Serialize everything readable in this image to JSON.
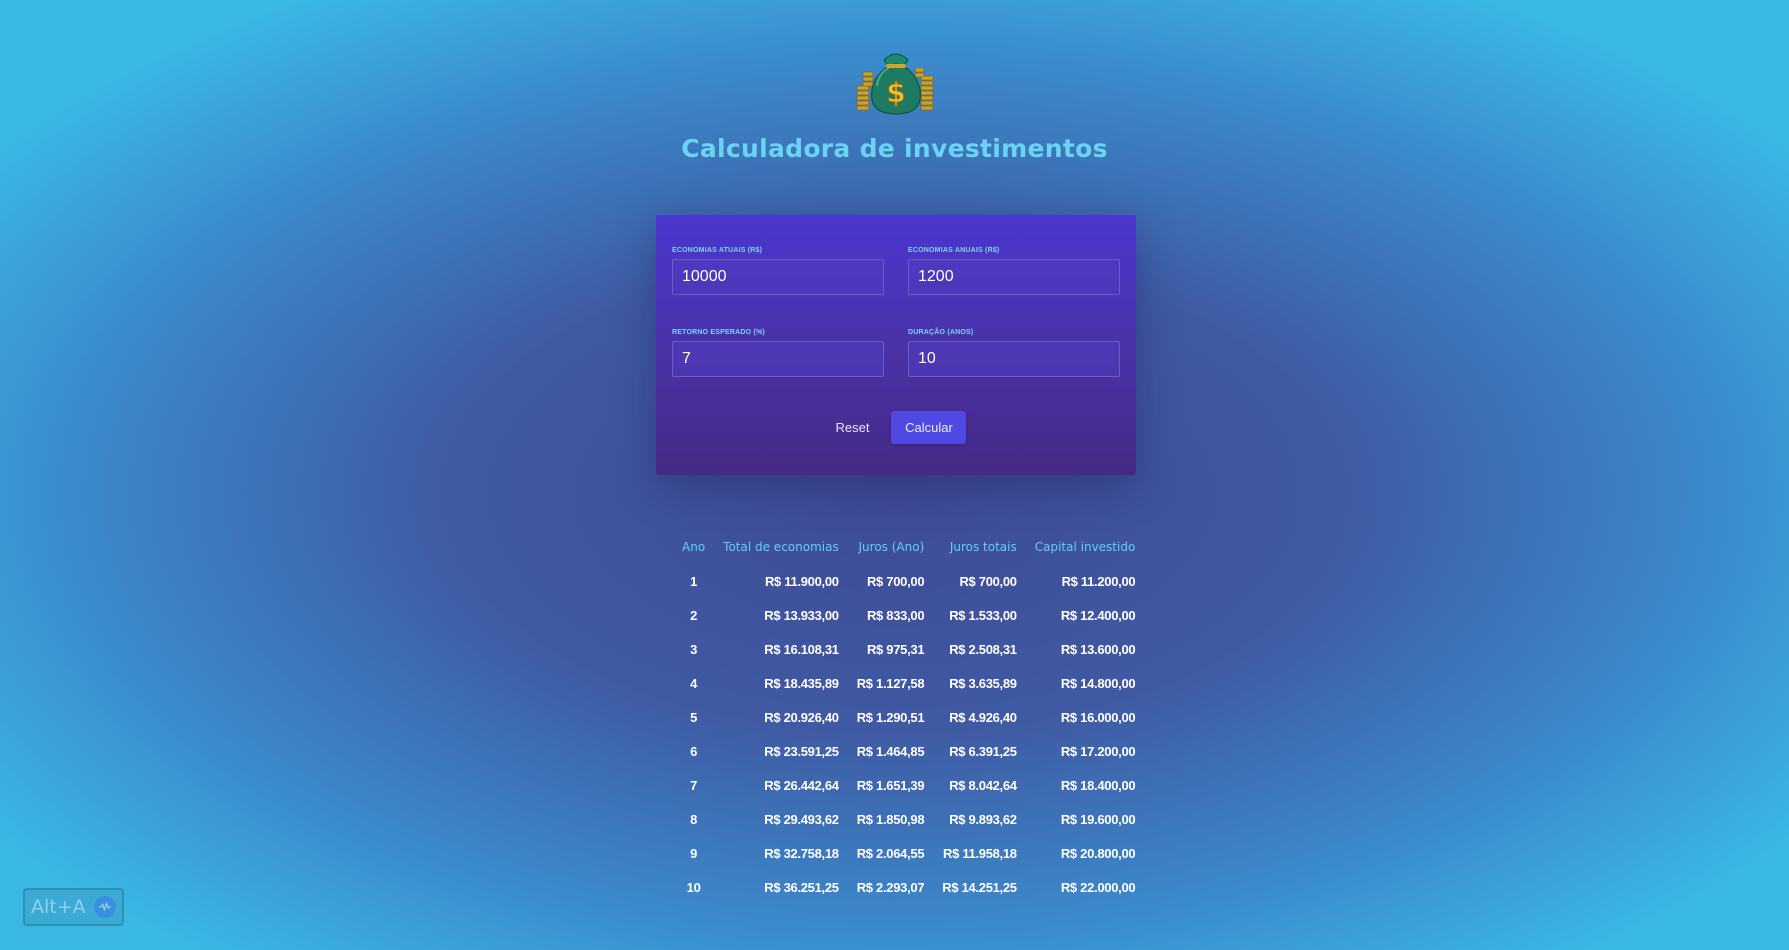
{
  "header": {
    "logo_icon": "money-bag-icon",
    "title": "Calculadora de investimentos"
  },
  "form": {
    "current_savings": {
      "label": "ECONOMIAS ATUAIS (R$)",
      "value": "10000"
    },
    "yearly_savings": {
      "label": "ECONOMIAS ANUAIS (R$)",
      "value": "1200"
    },
    "expected_return": {
      "label": "RETORNO ESPERADO (%)",
      "value": "7"
    },
    "duration": {
      "label": "DURAÇÃO (ANOS)",
      "value": "10"
    },
    "reset_label": "Reset",
    "calculate_label": "Calcular"
  },
  "table": {
    "headers": [
      "Ano",
      "Total de economias",
      "Juros (Ano)",
      "Juros totais",
      "Capital investido"
    ],
    "rows": [
      [
        "1",
        "R$ 11.900,00",
        "R$ 700,00",
        "R$ 700,00",
        "R$ 11.200,00"
      ],
      [
        "2",
        "R$ 13.933,00",
        "R$ 833,00",
        "R$ 1.533,00",
        "R$ 12.400,00"
      ],
      [
        "3",
        "R$ 16.108,31",
        "R$ 975,31",
        "R$ 2.508,31",
        "R$ 13.600,00"
      ],
      [
        "4",
        "R$ 18.435,89",
        "R$ 1.127,58",
        "R$ 3.635,89",
        "R$ 14.800,00"
      ],
      [
        "5",
        "R$ 20.926,40",
        "R$ 1.290,51",
        "R$ 4.926,40",
        "R$ 16.000,00"
      ],
      [
        "6",
        "R$ 23.591,25",
        "R$ 1.464,85",
        "R$ 6.391,25",
        "R$ 17.200,00"
      ],
      [
        "7",
        "R$ 26.442,64",
        "R$ 1.651,39",
        "R$ 8.042,64",
        "R$ 18.400,00"
      ],
      [
        "8",
        "R$ 29.493,62",
        "R$ 1.850,98",
        "R$ 9.893,62",
        "R$ 19.600,00"
      ],
      [
        "9",
        "R$ 32.758,18",
        "R$ 2.064,55",
        "R$ 11.958,18",
        "R$ 20.800,00"
      ],
      [
        "10",
        "R$ 36.251,25",
        "R$ 2.293,07",
        "R$ 14.251,25",
        "R$ 22.000,00"
      ]
    ]
  },
  "shortcut": {
    "label": "Alt+A",
    "icon": "assistant-icon"
  },
  "colors": {
    "title": "#6ad4f5",
    "card": "#4b36d0",
    "button": "#4f48e2",
    "table_header": "#5fd0f5"
  }
}
